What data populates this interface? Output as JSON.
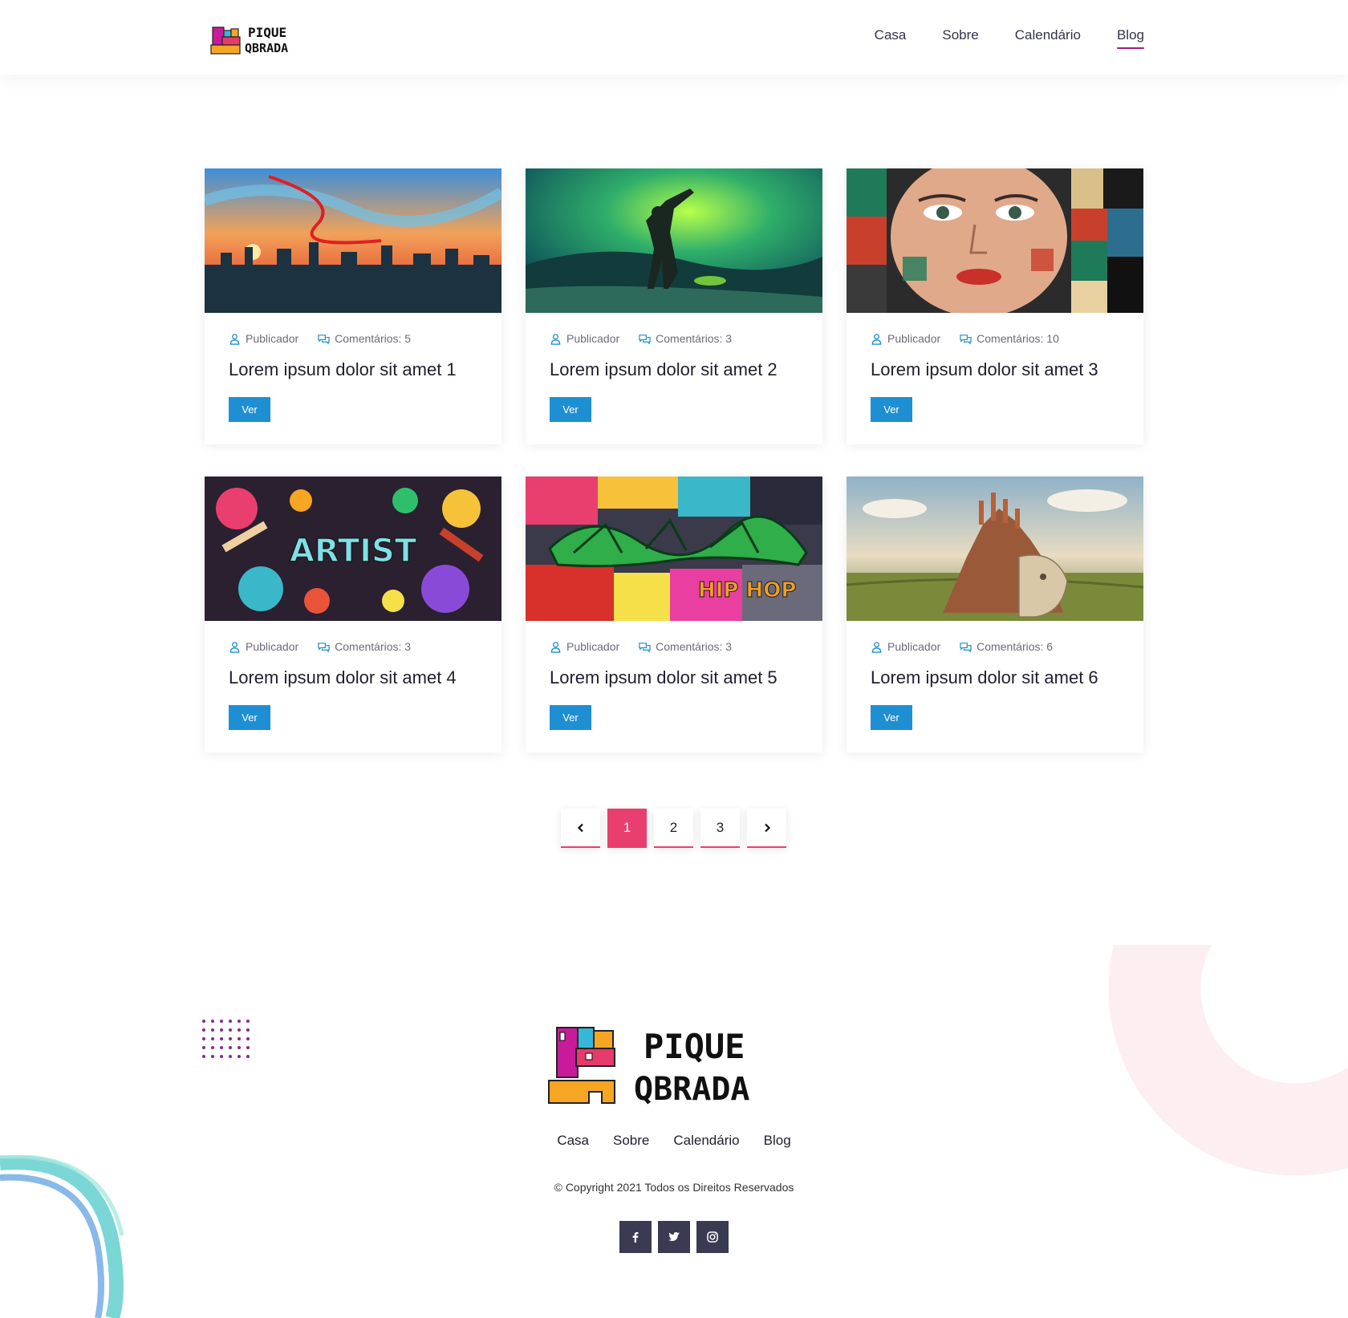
{
  "brand": {
    "logo_text_line1": "PIQUE",
    "logo_text_line2": "QBRADA"
  },
  "nav": {
    "items": [
      {
        "label": "Casa",
        "active": false
      },
      {
        "label": "Sobre",
        "active": false
      },
      {
        "label": "Calendário",
        "active": false
      },
      {
        "label": "Blog",
        "active": true
      }
    ]
  },
  "posts": [
    {
      "author": "Publicador",
      "comments": "Comentários: 5",
      "title": "Lorem ipsum dolor sit amet 1",
      "button": "Ver",
      "image": "sunset-city-painting"
    },
    {
      "author": "Publicador",
      "comments": "Comentários: 3",
      "title": "Lorem ipsum dolor sit amet 2",
      "button": "Ver",
      "image": "green-figure-painting"
    },
    {
      "author": "Publicador",
      "comments": "Comentários: 10",
      "title": "Lorem ipsum dolor sit amet 3",
      "button": "Ver",
      "image": "face-mural"
    },
    {
      "author": "Publicador",
      "comments": "Comentários: 3",
      "title": "Lorem ipsum dolor sit amet 4",
      "button": "Ver",
      "image": "artist-doodle"
    },
    {
      "author": "Publicador",
      "comments": "Comentários: 3",
      "title": "Lorem ipsum dolor sit amet 5",
      "button": "Ver",
      "image": "graffiti-wall"
    },
    {
      "author": "Publicador",
      "comments": "Comentários: 6",
      "title": "Lorem ipsum dolor sit amet 6",
      "button": "Ver",
      "image": "castle-head-landscape"
    }
  ],
  "pagination": {
    "prev_icon": "chevron-left-icon",
    "pages": [
      "1",
      "2",
      "3"
    ],
    "current": "1",
    "next_icon": "chevron-right-icon"
  },
  "footer": {
    "nav": [
      "Casa",
      "Sobre",
      "Calendário",
      "Blog"
    ],
    "copyright": "© Copyright 2021 Todos os Direitos Reservados",
    "social": [
      "facebook-icon",
      "twitter-icon",
      "instagram-icon"
    ]
  },
  "colors": {
    "accent": "#e83f6f",
    "button": "#1e8fd2",
    "nav_underline": "#a11c7a",
    "social_bg": "#3a3a52"
  }
}
